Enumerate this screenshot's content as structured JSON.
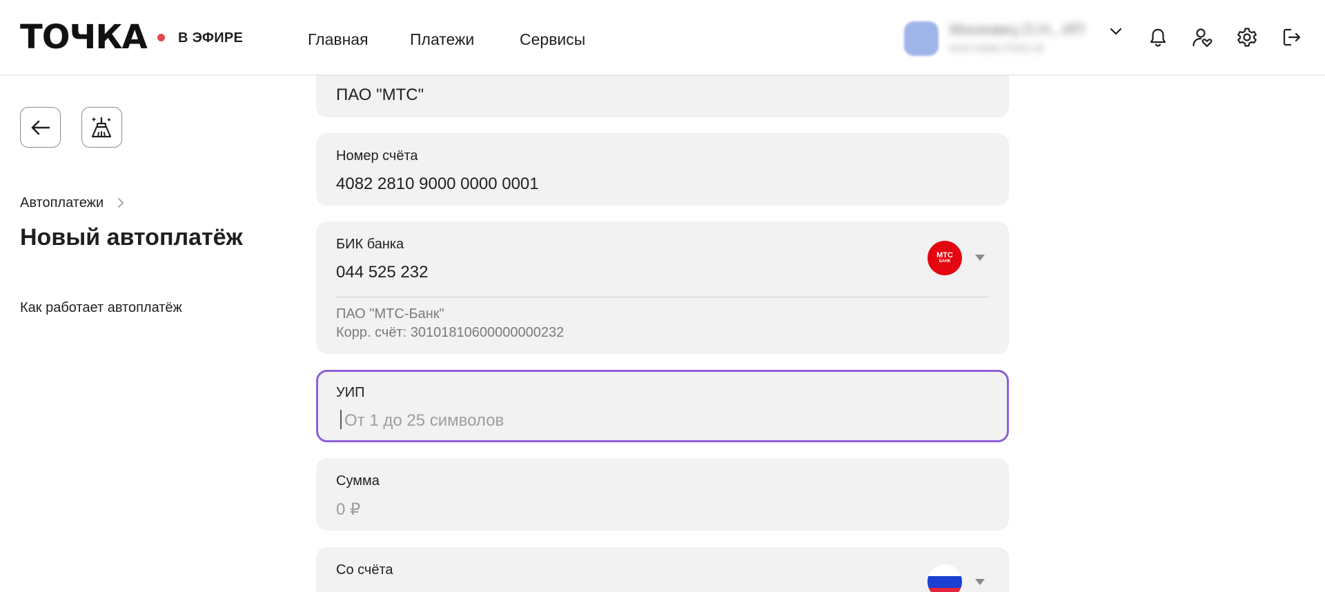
{
  "header": {
    "logo": "ТОЧКА",
    "live_label": "В ЭФИРЕ",
    "nav": [
      "Главная",
      "Платежи",
      "Сервисы"
    ],
    "user": {
      "name": "Московец О.Н., ИП",
      "inn": "ИНН 6408 07643 26"
    }
  },
  "sidebar": {
    "breadcrumb": "Автоплатежи",
    "title": "Новый автоплатёж",
    "help_link": "Как работает автоплатёж"
  },
  "form": {
    "recipient_value": "ПАО \"МТС\"",
    "account": {
      "label": "Номер счёта",
      "value": "4082 2810 9000 0000 0001"
    },
    "bik": {
      "label": "БИК банка",
      "value": "044 525 232",
      "logo_line1": "МТС",
      "logo_line2": "БАНК",
      "bank_name": "ПАО \"МТС-Банк\"",
      "corr_account": "Корр. счёт: 30101810600000000232"
    },
    "uip": {
      "label": "УИП",
      "placeholder": "От 1 до 25 символов"
    },
    "sum": {
      "label": "Сумма",
      "placeholder": "0 ₽"
    },
    "from_account": {
      "label": "Со счёта"
    }
  },
  "colors": {
    "accent_focus": "#8c5fd6",
    "live_dot": "#e3474f",
    "mts_red": "#e30611",
    "card_bg": "#f2f2f2"
  },
  "icons": [
    "bell-icon",
    "user-heart-icon",
    "gear-icon",
    "logout-icon",
    "arrow-left-icon",
    "broom-icon",
    "chevron-down-icon",
    "chevron-right-icon",
    "caret-down-icon",
    "ru-flag-icon"
  ]
}
